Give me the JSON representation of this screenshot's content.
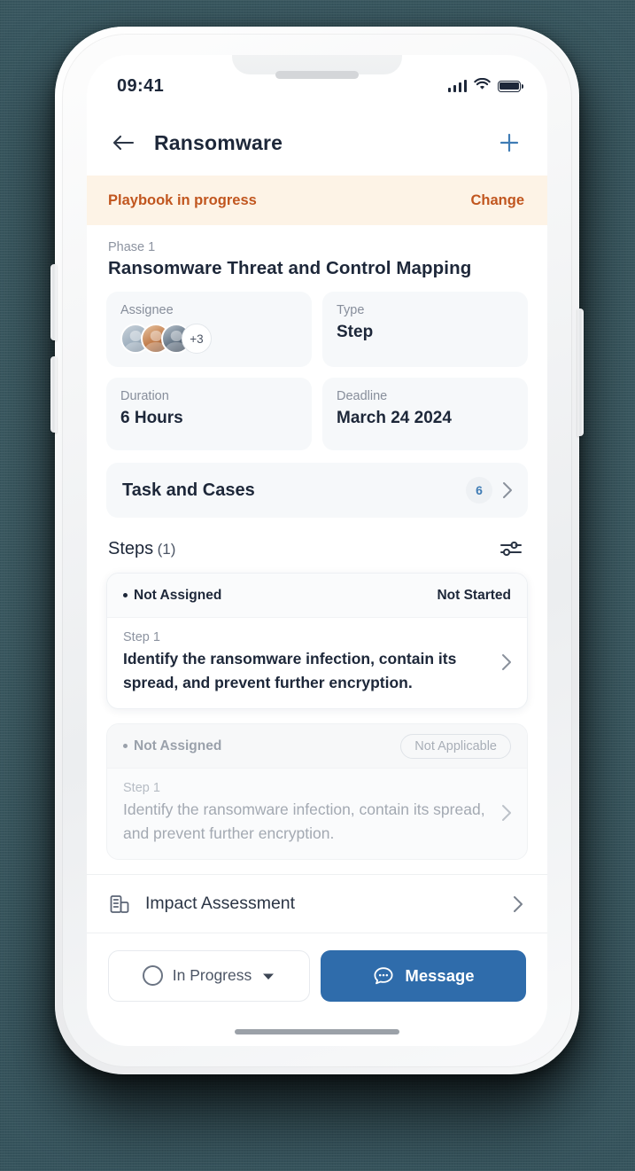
{
  "status_bar": {
    "time": "09:41",
    "signal_icon": "cellular-signal-icon",
    "wifi_icon": "wifi-icon",
    "battery_icon": "battery-full-icon"
  },
  "nav": {
    "back_icon": "arrow-left-icon",
    "title": "Ransomware",
    "add_icon": "plus-icon"
  },
  "banner": {
    "status": "Playbook in progress",
    "action": "Change",
    "text_color": "#c1561f",
    "background_color": "#fdf3e6"
  },
  "phase": {
    "label": "Phase 1",
    "title": "Ransomware Threat and Control Mapping"
  },
  "info_cards": [
    {
      "label": "Assignee",
      "value": "",
      "avatar_overflow": "+3"
    },
    {
      "label": "Type",
      "value": "Step"
    },
    {
      "label": "Duration",
      "value": "6 Hours"
    },
    {
      "label": "Deadline",
      "value": "March 24 2024"
    }
  ],
  "task_cases": {
    "label": "Task and Cases",
    "count": "6",
    "count_color": "#3f7cb5",
    "chevron_icon": "chevron-right-icon"
  },
  "steps_section": {
    "heading": "Steps",
    "count": "(1)",
    "filter_icon": "sliders-filter-icon"
  },
  "steps": [
    {
      "assignee": "Not Assigned",
      "status": "Not Started",
      "status_style": "plain",
      "number": "Step 1",
      "description": "Identify the ransomware infection, contain its spread, and prevent further encryption.",
      "chevron_icon": "chevron-right-icon"
    },
    {
      "assignee": "Not Assigned",
      "status": "Not Applicable",
      "status_style": "pill",
      "number": "Step 1",
      "description": "Identify the ransomware infection, contain its spread, and prevent further encryption.",
      "chevron_icon": "chevron-right-icon"
    }
  ],
  "impact": {
    "icon": "building-icon",
    "label": "Impact Assessment",
    "chevron_icon": "chevron-right-icon"
  },
  "action_bar": {
    "status_icon": "circle-outline-icon",
    "status_label": "In Progress",
    "dropdown_icon": "caret-down-icon",
    "message_icon": "chat-bubble-icon",
    "message_label": "Message",
    "message_color": "#2f6cab"
  }
}
